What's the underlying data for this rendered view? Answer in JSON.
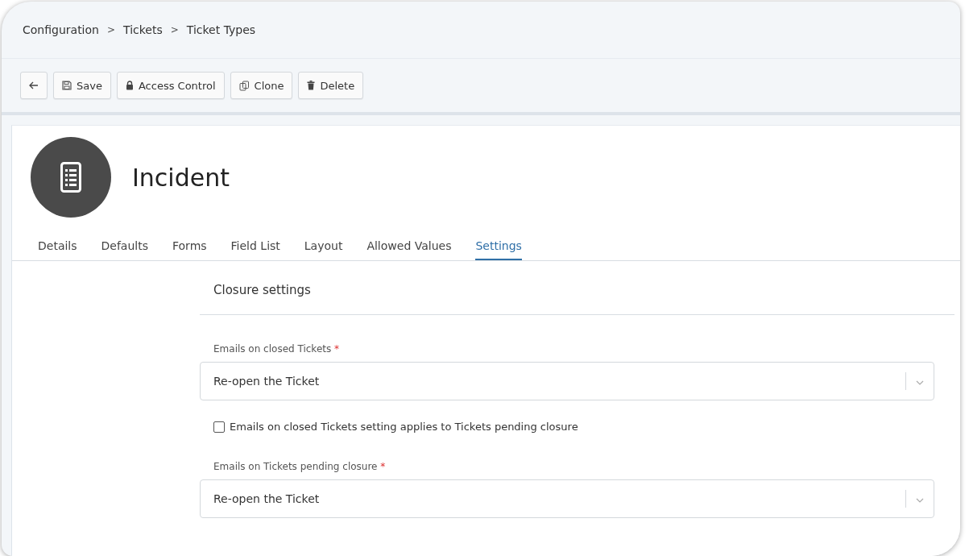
{
  "breadcrumb": [
    {
      "label": "Configuration"
    },
    {
      "label": "Tickets"
    },
    {
      "label": "Ticket Types"
    }
  ],
  "breadcrumb_separator": ">",
  "toolbar": [
    {
      "kind": "back"
    },
    {
      "kind": "save",
      "label": "Save"
    },
    {
      "kind": "lock",
      "label": "Access Control"
    },
    {
      "kind": "clone",
      "label": "Clone"
    },
    {
      "kind": "delete",
      "label": "Delete"
    }
  ],
  "title": "Incident",
  "tabs": [
    {
      "label": "Details",
      "selected": false
    },
    {
      "label": "Defaults",
      "selected": false
    },
    {
      "label": "Forms",
      "selected": false
    },
    {
      "label": "Field List",
      "selected": false
    },
    {
      "label": "Layout",
      "selected": false
    },
    {
      "label": "Allowed Values",
      "selected": false
    },
    {
      "label": "Settings",
      "selected": true
    }
  ],
  "section": {
    "title": "Closure settings",
    "fields": [
      {
        "kind": "select",
        "label": "Emails on closed Tickets",
        "required_mark": "*",
        "value": "Re-open the Ticket"
      },
      {
        "kind": "checkbox",
        "label": "Emails on closed Tickets setting applies to Tickets pending closure",
        "checked": false
      },
      {
        "kind": "select",
        "label": "Emails on Tickets pending closure",
        "required_mark": "*",
        "value": "Re-open the Ticket"
      }
    ]
  }
}
